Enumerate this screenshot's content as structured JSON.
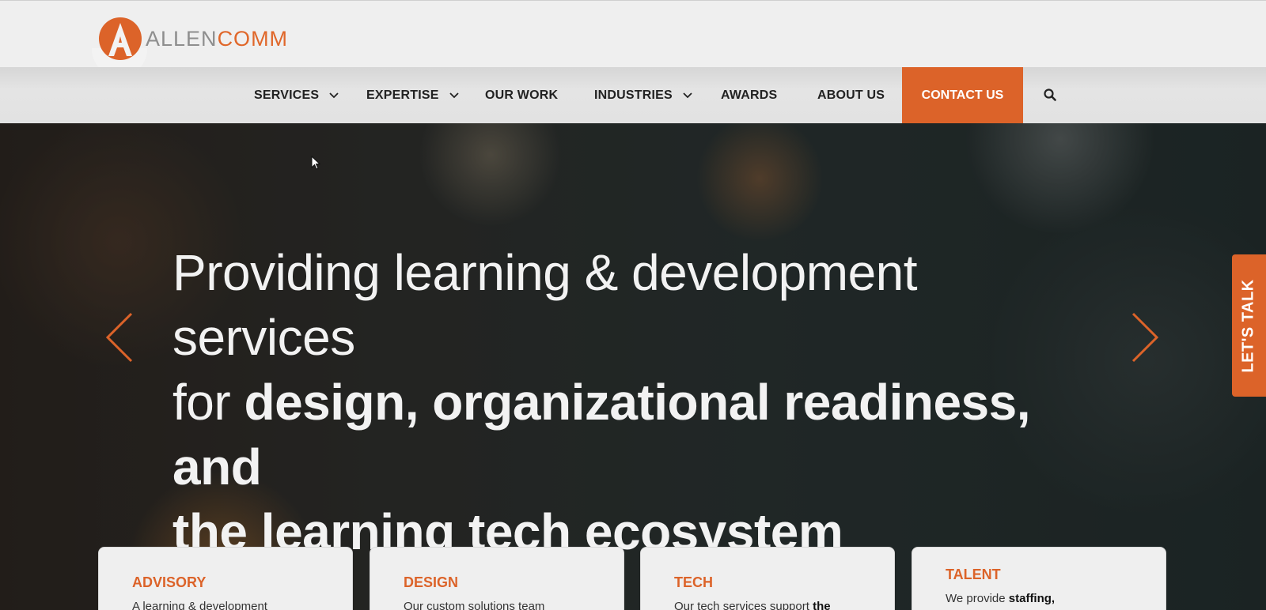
{
  "header": {
    "logo": {
      "text_part1": "ALLEN",
      "text_part2": "COMM",
      "brand_color": "#dc6329"
    }
  },
  "nav": {
    "items": [
      {
        "label": "SERVICES",
        "has_dropdown": true
      },
      {
        "label": "EXPERTISE",
        "has_dropdown": true
      },
      {
        "label": "OUR WORK",
        "has_dropdown": false
      },
      {
        "label": "INDUSTRIES",
        "has_dropdown": true
      },
      {
        "label": "AWARDS",
        "has_dropdown": false
      },
      {
        "label": "ABOUT US",
        "has_dropdown": false
      }
    ],
    "contact_label": "CONTACT US",
    "search_icon": "search-icon"
  },
  "hero": {
    "line1": "Providing learning & development services",
    "line2_regular": "for ",
    "line2_bold": "design, organizational readiness, and",
    "line3_bold": "the learning tech ecosystem"
  },
  "side_tab": {
    "label": "LET'S TALK"
  },
  "cards": [
    {
      "title": "ADVISORY",
      "desc": "A learning & development",
      "desc_bold": ""
    },
    {
      "title": "DESIGN",
      "desc": "Our custom solutions team",
      "desc_bold": ""
    },
    {
      "title": "TECH",
      "desc": "Our tech services support ",
      "desc_bold": "the"
    },
    {
      "title": "TALENT",
      "desc": "We provide ",
      "desc_bold": "staffing,"
    }
  ]
}
